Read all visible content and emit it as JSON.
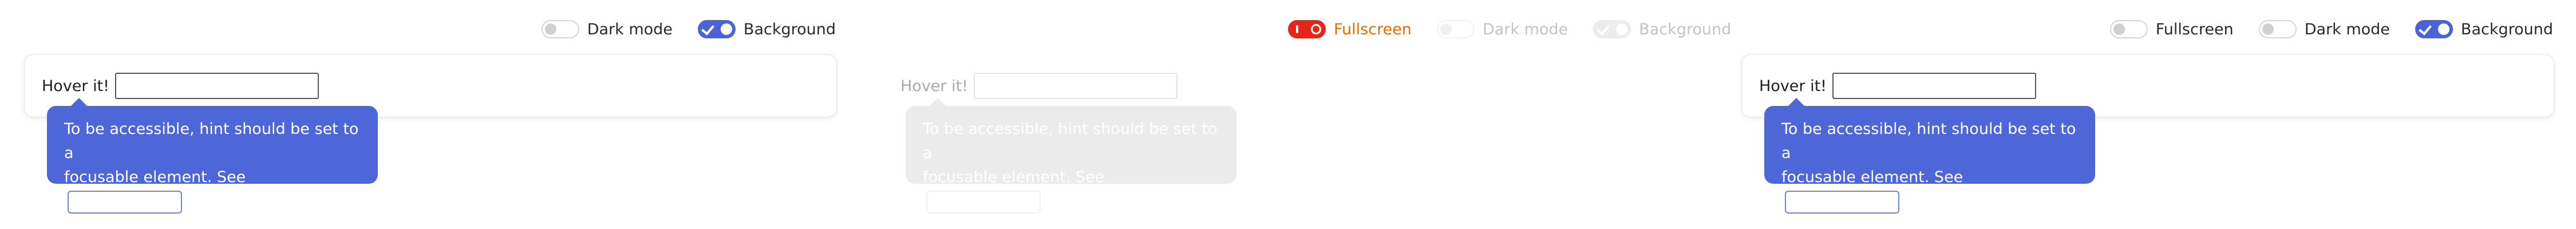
{
  "panels": [
    {
      "toggles": [
        {
          "label": "Dark mode",
          "state": "off"
        },
        {
          "label": "Background",
          "state": "on"
        }
      ],
      "hover_label": "Hover it!",
      "input_value": "",
      "tooltip": {
        "line1": "To be accessible, hint should be set to a",
        "line2": "focusable element. See",
        "link_text": ""
      }
    },
    {
      "toggles": [
        {
          "label": "Fullscreen",
          "state": "danger"
        },
        {
          "label": "Dark mode",
          "state": "disabled-off"
        },
        {
          "label": "Background",
          "state": "disabled-on"
        }
      ],
      "hover_label": "Hover it!",
      "input_value": "",
      "tooltip": {
        "line1": "To be accessible, hint should be set to a",
        "line2": "focusable element. See",
        "link_text": ""
      }
    },
    {
      "toggles": [
        {
          "label": "Fullscreen",
          "state": "off"
        },
        {
          "label": "Dark mode",
          "state": "off"
        },
        {
          "label": "Background",
          "state": "on"
        }
      ],
      "hover_label": "Hover it!",
      "input_value": "",
      "tooltip": {
        "line1": "To be accessible, hint should be set to a",
        "line2": "focusable element. See",
        "link_text": ""
      }
    }
  ],
  "colors": {
    "accent": "#4a63d6",
    "tooltip": "#4d66d8",
    "danger": "#e8231a",
    "danger_label": "#e86a00"
  }
}
